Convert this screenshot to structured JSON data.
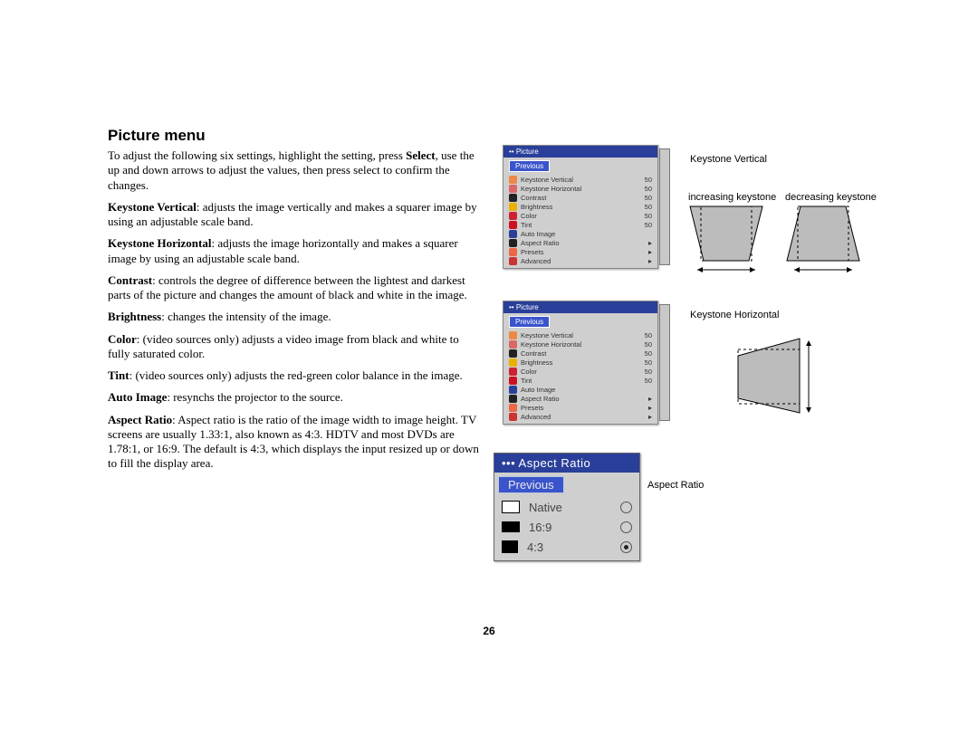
{
  "page": {
    "number": "26",
    "title": "Picture menu"
  },
  "body": {
    "intro_pre": "To adjust the following six settings, highlight the setting, press ",
    "intro_bold": "Select",
    "intro_post": ", use the up and down arrows to adjust the values, then press select to confirm the changes.",
    "kv_label": "Keystone Vertical",
    "kv_text": ": adjusts the image vertically and makes a squarer image by using an adjustable scale band.",
    "kh_label": "Keystone Horizontal",
    "kh_text": ": adjusts the image horizontally and makes a squarer image by using an adjustable scale band.",
    "co_label": "Contrast",
    "co_text": ": controls the degree of difference between the lightest and darkest parts of the picture and changes the amount of black and white in the image.",
    "br_label": "Brightness",
    "br_text": ": changes the intensity of the image.",
    "cl_label": "Color",
    "cl_text": ": (video sources only) adjusts a video image from black and white to fully saturated color.",
    "ti_label": "Tint",
    "ti_text": ": (video sources only) adjusts the red-green color balance in the image.",
    "ai_label": "Auto Image",
    "ai_text": ": resynchs the projector to the source.",
    "ar_label": "Aspect Ratio",
    "ar_text": ": Aspect ratio is the ratio of the image width to image height. TV screens are usually 1.33:1, also known as 4:3. HDTV and most DVDs are 1.78:1, or 16:9. The default is 4:3, which displays the input resized up or down to fill the display area."
  },
  "osd": {
    "headline": "Picture",
    "previous": "Previous",
    "value_default": "50",
    "items": [
      {
        "label": "Keystone Vertical",
        "val": "50"
      },
      {
        "label": "Keystone Horizontal",
        "val": "50"
      },
      {
        "label": "Contrast",
        "val": "50"
      },
      {
        "label": "Brightness",
        "val": "50"
      },
      {
        "label": "Color",
        "val": "50"
      },
      {
        "label": "Tint",
        "val": "50"
      },
      {
        "label": "Auto Image",
        "val": ""
      },
      {
        "label": "Aspect Ratio",
        "arrow": true
      },
      {
        "label": "Presets",
        "arrow": true
      },
      {
        "label": "Advanced",
        "arrow": true
      }
    ]
  },
  "captions": {
    "kv": "Keystone Vertical",
    "inc": "increasing keystone",
    "dec": "decreasing keystone",
    "kh": "Keystone Horizontal",
    "ar": "Aspect Ratio"
  },
  "aspect": {
    "title": "••• Aspect Ratio",
    "prev": "Previous",
    "native": "Native",
    "r169": "16:9",
    "r43": "4:3",
    "selected": "4:3"
  }
}
